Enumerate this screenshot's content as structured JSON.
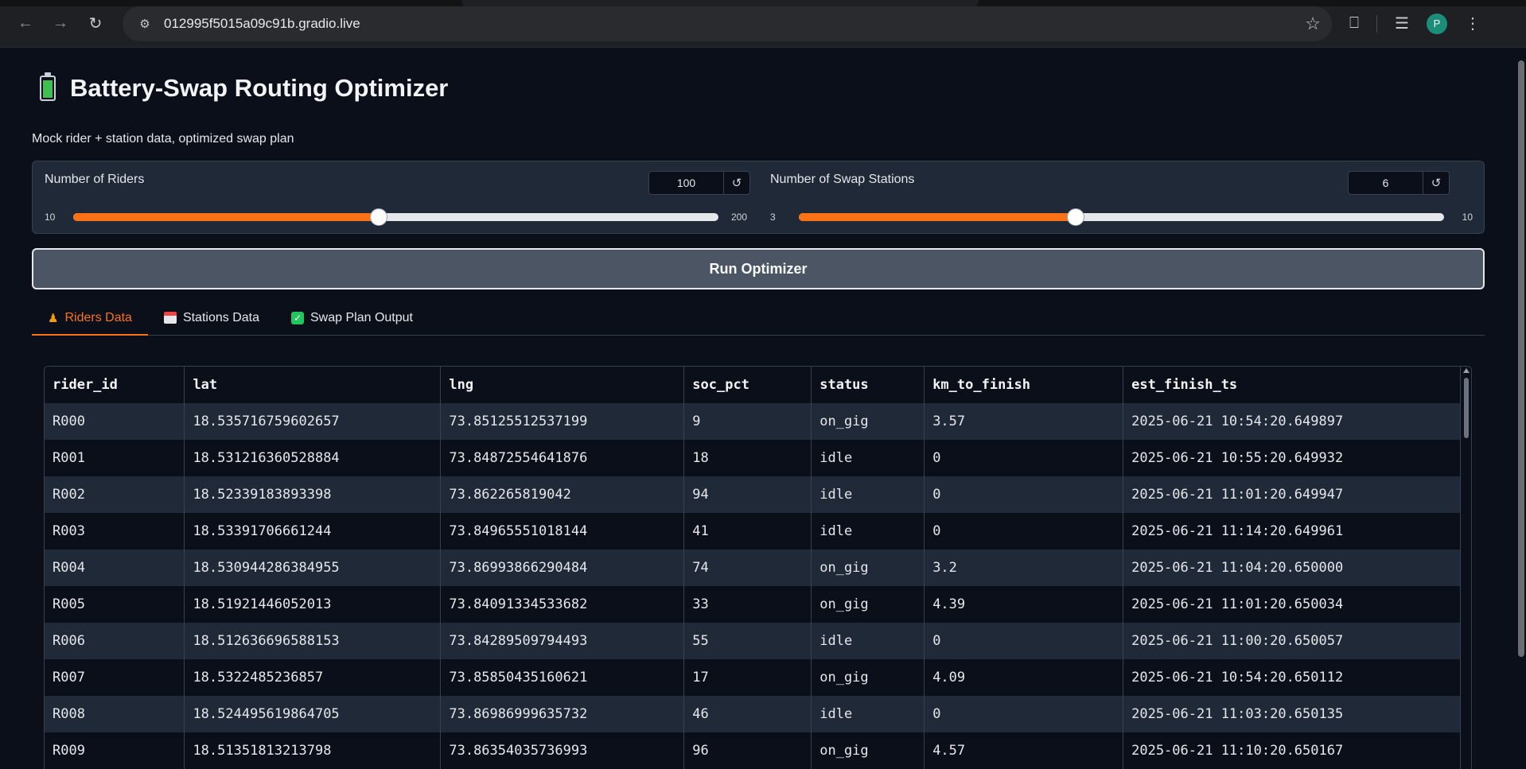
{
  "browser": {
    "url": "012995f5015a09c91b.gradio.live",
    "avatar_letter": "P"
  },
  "header": {
    "title": "Battery-Swap Routing Optimizer",
    "subtitle": "Mock rider + station data, optimized swap plan"
  },
  "sliders": {
    "riders": {
      "label": "Number of Riders",
      "value": "100",
      "min": "10",
      "max": "200",
      "fraction": 0.4737
    },
    "stations": {
      "label": "Number of Swap Stations",
      "value": "6",
      "min": "3",
      "max": "10",
      "fraction": 0.4286
    }
  },
  "run_button": "Run Optimizer",
  "tabs": [
    {
      "label": "Riders Data",
      "active": true
    },
    {
      "label": "Stations Data",
      "active": false
    },
    {
      "label": "Swap Plan Output",
      "active": false
    }
  ],
  "table": {
    "columns": [
      "rider_id",
      "lat",
      "lng",
      "soc_pct",
      "status",
      "km_to_finish",
      "est_finish_ts"
    ],
    "rows": [
      [
        "R000",
        "18.535716759602657",
        "73.85125512537199",
        "9",
        "on_gig",
        "3.57",
        "2025-06-21 10:54:20.649897"
      ],
      [
        "R001",
        "18.531216360528884",
        "73.84872554641876",
        "18",
        "idle",
        "0",
        "2025-06-21 10:55:20.649932"
      ],
      [
        "R002",
        "18.52339183893398",
        "73.862265819042",
        "94",
        "idle",
        "0",
        "2025-06-21 11:01:20.649947"
      ],
      [
        "R003",
        "18.53391706661244",
        "73.84965551018144",
        "41",
        "idle",
        "0",
        "2025-06-21 11:14:20.649961"
      ],
      [
        "R004",
        "18.530944286384955",
        "73.86993866290484",
        "74",
        "on_gig",
        "3.2",
        "2025-06-21 11:04:20.650000"
      ],
      [
        "R005",
        "18.51921446052013",
        "73.84091334533682",
        "33",
        "on_gig",
        "4.39",
        "2025-06-21 11:01:20.650034"
      ],
      [
        "R006",
        "18.512636696588153",
        "73.84289509794493",
        "55",
        "idle",
        "0",
        "2025-06-21 11:00:20.650057"
      ],
      [
        "R007",
        "18.5322485236857",
        "73.85850435160621",
        "17",
        "on_gig",
        "4.09",
        "2025-06-21 10:54:20.650112"
      ],
      [
        "R008",
        "18.524495619864705",
        "73.86986999635732",
        "46",
        "idle",
        "0",
        "2025-06-21 11:03:20.650135"
      ],
      [
        "R009",
        "18.51351813213798",
        "73.86354035736993",
        "96",
        "on_gig",
        "4.57",
        "2025-06-21 11:10:20.650167"
      ]
    ]
  }
}
